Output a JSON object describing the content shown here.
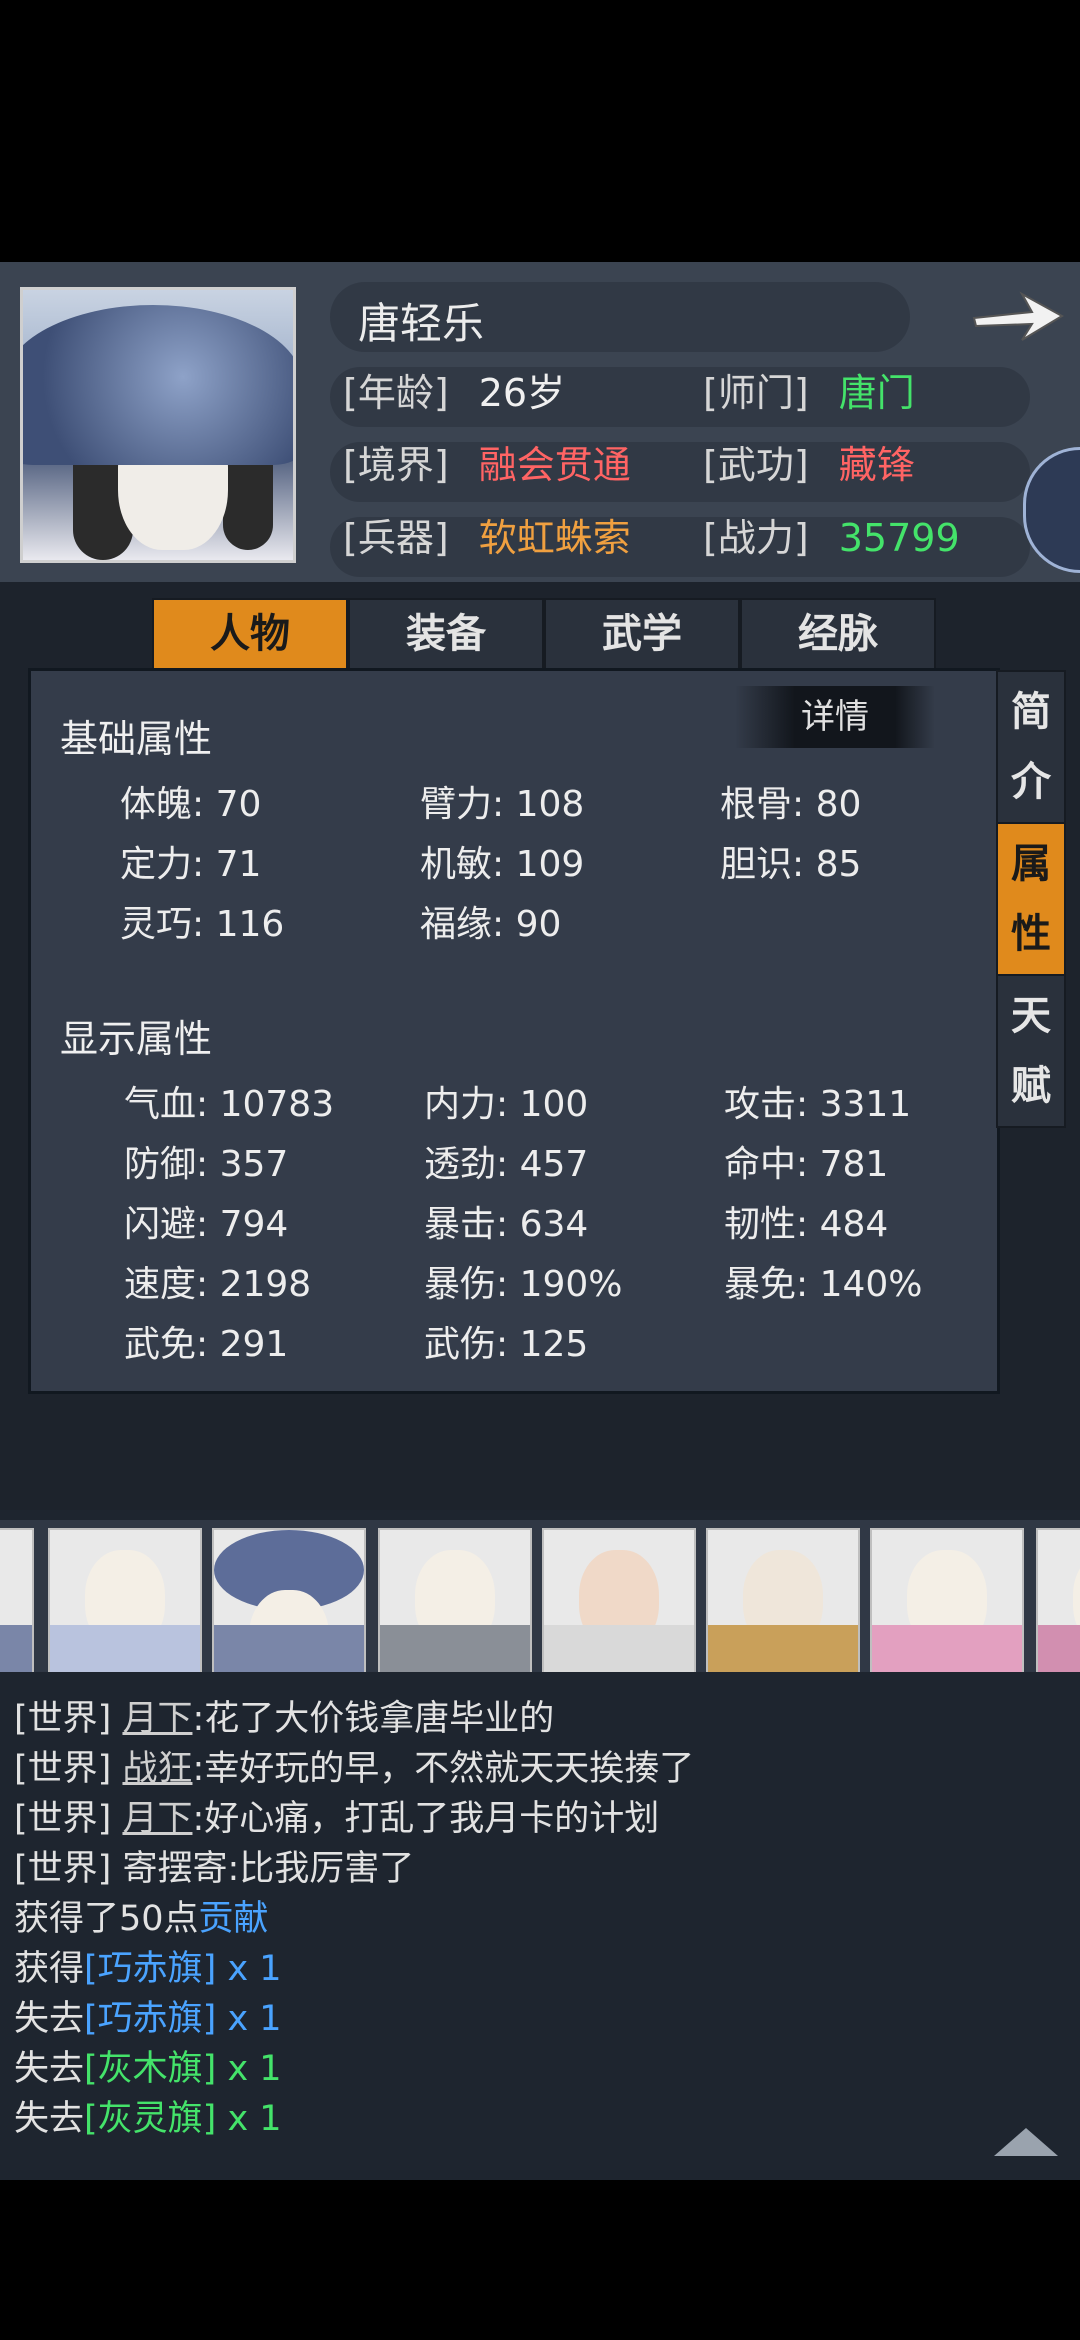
{
  "character": {
    "name": "唐轻乐",
    "age_label": "[年龄]",
    "age_value": "26岁",
    "sect_label": "[师门]",
    "sect_value": "唐门",
    "realm_label": "[境界]",
    "realm_value": "融会贯通",
    "martial_label": "[武功]",
    "martial_value": "藏锋",
    "weapon_label": "[兵器]",
    "weapon_value": "软虹蛛索",
    "power_label": "[战力]",
    "power_value": "35799"
  },
  "tabs": [
    "人物",
    "装备",
    "武学",
    "经脉"
  ],
  "side_tabs": [
    {
      "c1": "简",
      "c2": "介"
    },
    {
      "c1": "属",
      "c2": "性"
    },
    {
      "c1": "天",
      "c2": "赋"
    }
  ],
  "basic": {
    "title": "基础属性",
    "detail_label": "详情",
    "stats": [
      "体魄: 70",
      "臂力: 108",
      "根骨: 80",
      "定力: 71",
      "机敏: 109",
      "胆识: 85",
      "灵巧: 116",
      "福缘: 90"
    ]
  },
  "display": {
    "title": "显示属性",
    "stats": [
      "气血: 10783",
      "内力: 100",
      "攻击: 3311",
      "防御: 357",
      "透劲: 457",
      "命中: 781",
      "闪避: 794",
      "暴击: 634",
      "韧性: 484",
      "速度: 2198",
      "暴伤: 190%",
      "暴免: 140%",
      "武免: 291",
      "武伤: 125"
    ]
  },
  "chat": [
    {
      "prefix": "[世界]",
      "user": "月下",
      "msg": ":花了大价钱拿唐毕业的"
    },
    {
      "prefix": "[世界]",
      "user": "战狂",
      "msg": ":幸好玩的早，不然就天天挨揍了"
    },
    {
      "prefix": "[世界]",
      "user": "月下",
      "msg": ":好心痛，打乱了我月卡的计划"
    },
    {
      "prefix": "[世界]",
      "user": "寄摆寄",
      "msg": ":比我厉害了"
    }
  ],
  "loot": [
    {
      "pre": "获得了50点",
      "item": "贡献",
      "qty": ""
    },
    {
      "pre": "获得",
      "item": "[巧赤旗]",
      "qty": " x 1"
    },
    {
      "pre": "失去",
      "item": "[巧赤旗]",
      "qty": " x 1"
    },
    {
      "pre": "失去",
      "item": "[灰木旗]",
      "qty": " x 1"
    },
    {
      "pre": "失去",
      "item": "[灰灵旗]",
      "qty": " x 1"
    }
  ]
}
